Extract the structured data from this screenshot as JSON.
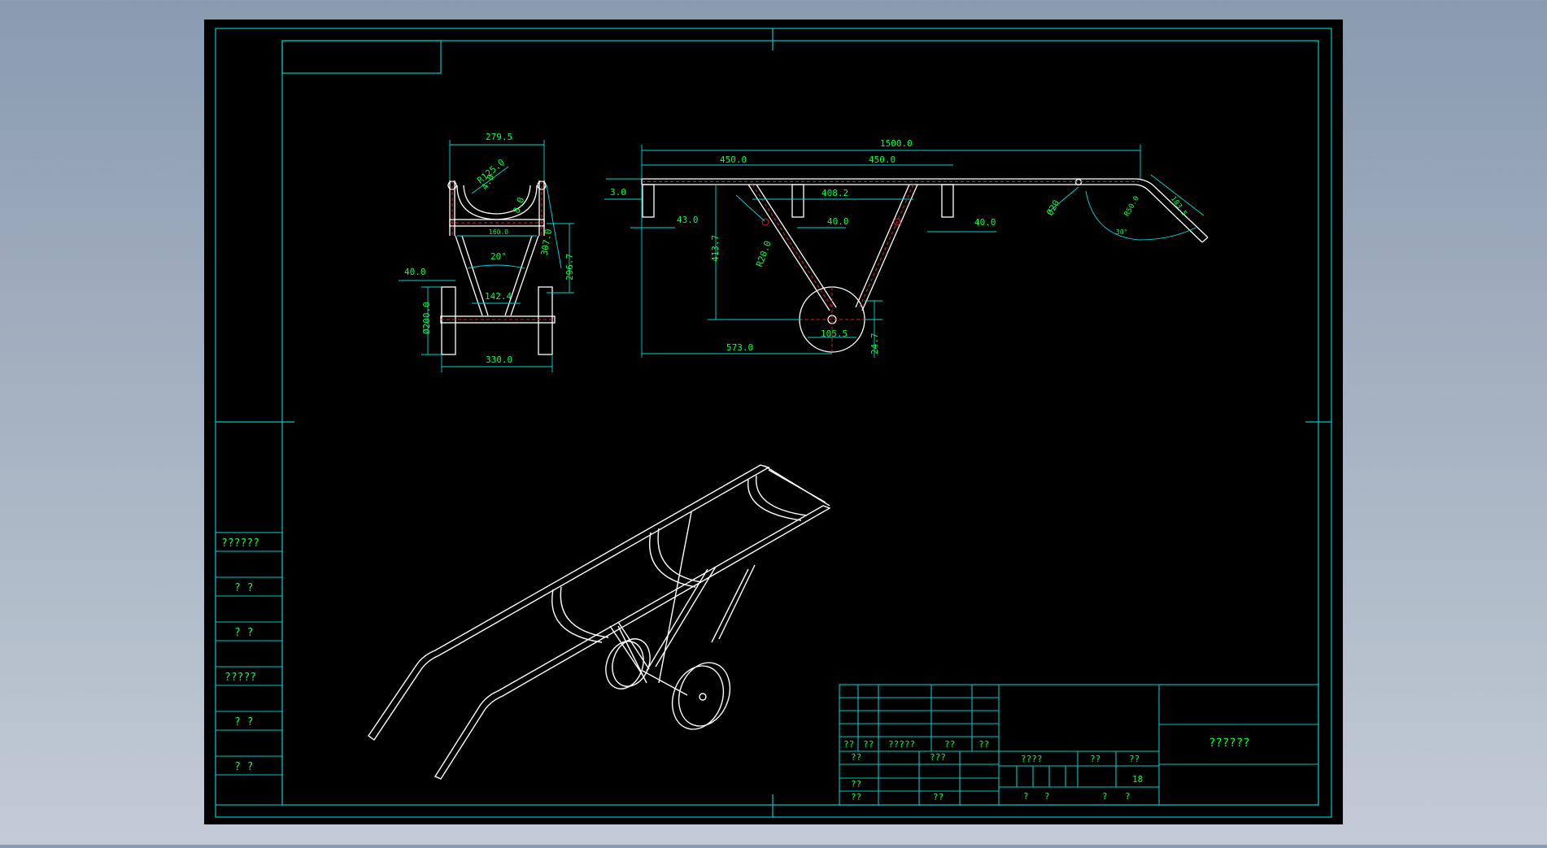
{
  "colors": {
    "background_gradient_top": "#8a9bb0",
    "background_gradient_bottom": "#c3cbd6",
    "sheet": "#000000",
    "border": "#00c8c8",
    "dimension": "#00d8d8",
    "dim_text": "#00ff40",
    "outline": "#ffffff",
    "hidden_line": "#e02020"
  },
  "drawing": {
    "side_table": [
      "??????",
      "? ?",
      "? ?",
      "?????",
      "? ?",
      "? ?"
    ],
    "front_view_dims": {
      "top_width": "279.5",
      "radius": "R125.0",
      "wall_a": "4.0",
      "wall_b": "8.0",
      "inner_width": "160.0",
      "angle": "20°",
      "base_width": "142.4",
      "side_height": "307.0",
      "total_height": "296.7",
      "wheel_offset": "40.0",
      "wheel_dia": "Ø200.0",
      "track_width": "330.0"
    },
    "side_view_dims": {
      "total_length": "1500.0",
      "seg_left": "450.0",
      "seg_right": "450.0",
      "mid_span": "408.2",
      "thickness": "3.0",
      "left_offset": "43.0",
      "mid_offset": "40.0",
      "right_offset": "40.0",
      "height": "413.7",
      "leg_radius": "R20.0",
      "wheel_pos": "573.0",
      "wheel_width": "105.5",
      "axle_offset": "24.7",
      "handle_dia": "Ø20",
      "bend_radius": "R50.0",
      "bend_angle": "30°",
      "handle_length": "183.5"
    },
    "title_block": {
      "header_row": [
        "??",
        "??",
        "?????",
        "??",
        "??"
      ],
      "row1": [
        "??",
        "???"
      ],
      "row2": [
        "??"
      ],
      "row3": [
        "??",
        "??"
      ],
      "info_labels": [
        "????",
        "??",
        "??"
      ],
      "sheet_count": "18",
      "bottom_labels": [
        "?",
        "?",
        "?",
        "?"
      ],
      "drawing_title": "??????"
    }
  }
}
